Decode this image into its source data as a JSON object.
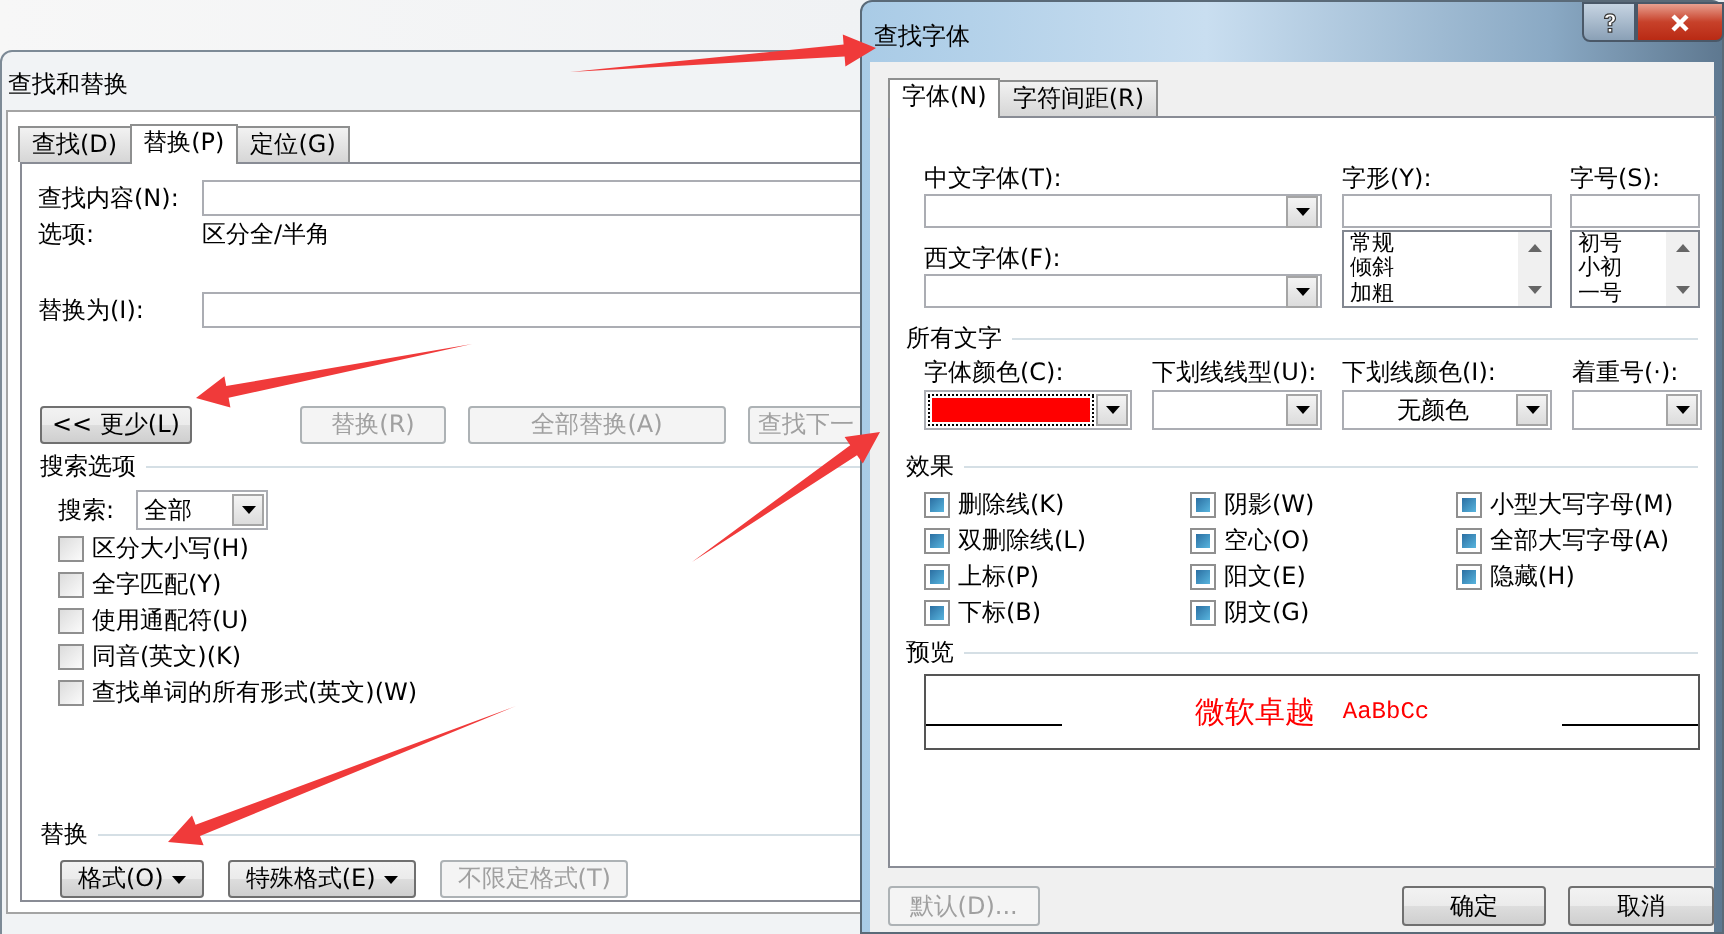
{
  "find_replace_window": {
    "title": "查找和替换",
    "tabs": [
      {
        "label": "查找(D)",
        "selected": false
      },
      {
        "label": "替换(P)",
        "selected": true
      },
      {
        "label": "定位(G)",
        "selected": false
      }
    ],
    "find_field": {
      "label": "查找内容(N):"
    },
    "options": {
      "label": "选项:",
      "value": "区分全/半角"
    },
    "replace_field": {
      "label": "替换为(I):"
    },
    "buttons": [
      {
        "label": "<< 更少(L)",
        "disabled": false
      },
      {
        "label": "替换(R)",
        "disabled": true
      },
      {
        "label": "全部替换(A)",
        "disabled": true
      },
      {
        "label": "查找下一",
        "disabled": true
      }
    ],
    "search_options": {
      "title": "搜索选项",
      "search_label": "搜索:",
      "search_value": "全部",
      "checkboxes": [
        {
          "label": "区分大小写(H)",
          "checked": false
        },
        {
          "label": "全字匹配(Y)",
          "checked": false
        },
        {
          "label": "使用通配符(U)",
          "checked": false
        },
        {
          "label": "同音(英文)(K)",
          "checked": false
        },
        {
          "label": "查找单词的所有形式(英文)(W)",
          "checked": false
        }
      ]
    },
    "replace_section": {
      "title": "替换",
      "buttons": [
        {
          "label": "格式(O)",
          "dropdown": true,
          "disabled": false
        },
        {
          "label": "特殊格式(E)",
          "dropdown": true,
          "disabled": false
        },
        {
          "label": "不限定格式(T)",
          "dropdown": false,
          "disabled": true
        }
      ]
    }
  },
  "find_font_window": {
    "title": "查找字体",
    "tabs": [
      {
        "label": "字体(N)",
        "selected": true
      },
      {
        "label": "字符间距(R)",
        "selected": false
      }
    ],
    "chinese_font": {
      "label": "中文字体(T):"
    },
    "western_font": {
      "label": "西文字体(F):"
    },
    "font_style": {
      "label": "字形(Y):",
      "items": [
        "常规",
        "倾斜",
        "加粗"
      ]
    },
    "font_size": {
      "label": "字号(S):",
      "items": [
        "初号",
        "小初",
        "一号"
      ]
    },
    "all_text": {
      "title": "所有文字",
      "font_color": {
        "label": "字体颜色(C):",
        "color": "#ff0000"
      },
      "underline_style": {
        "label": "下划线线型(U):"
      },
      "underline_color": {
        "label": "下划线颜色(I):",
        "value": "无颜色"
      },
      "emphasis_mark": {
        "label": "着重号(·):"
      }
    },
    "effects": {
      "title": "效果",
      "checkboxes": [
        {
          "label": "删除线(K)",
          "indeterminate": true
        },
        {
          "label": "阴影(W)",
          "indeterminate": true
        },
        {
          "label": "小型大写字母(M)",
          "indeterminate": true
        },
        {
          "label": "双删除线(L)",
          "indeterminate": true
        },
        {
          "label": "空心(O)",
          "indeterminate": true
        },
        {
          "label": "全部大写字母(A)",
          "indeterminate": true
        },
        {
          "label": "上标(P)",
          "indeterminate": true
        },
        {
          "label": "阳文(E)",
          "indeterminate": true
        },
        {
          "label": "隐藏(H)",
          "indeterminate": true
        },
        {
          "label": "下标(B)",
          "indeterminate": true
        },
        {
          "label": "阴文(G)",
          "indeterminate": true
        }
      ]
    },
    "preview": {
      "title": "预览",
      "sample_chinese": "微软卓越",
      "sample_latin": "AaBbCc"
    },
    "buttons": [
      {
        "label": "默认(D)...",
        "disabled": true
      },
      {
        "label": "确定",
        "disabled": false
      },
      {
        "label": "取消",
        "disabled": false
      }
    ]
  },
  "annotations": [
    {
      "kind": "arrow"
    },
    {
      "kind": "arrow"
    },
    {
      "kind": "arrow"
    },
    {
      "kind": "arrow"
    }
  ]
}
